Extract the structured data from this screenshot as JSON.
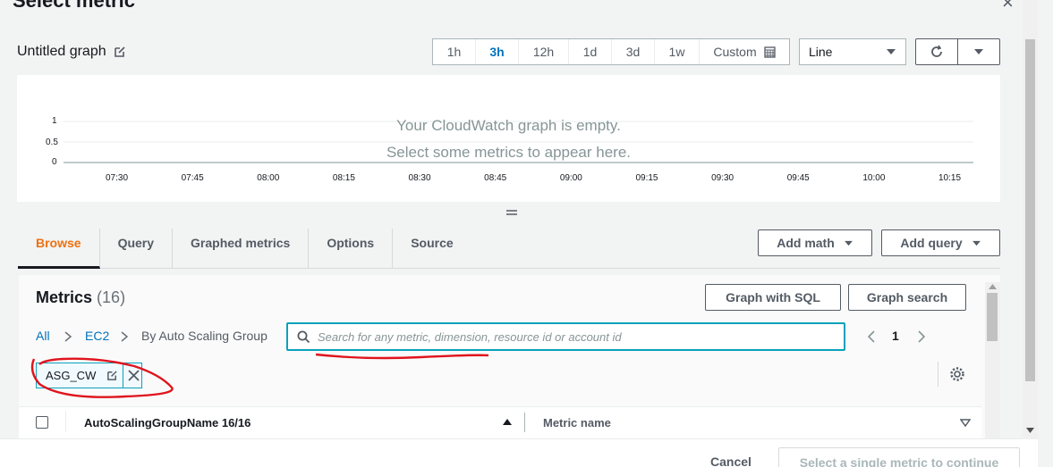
{
  "modal": {
    "title": "Select metric",
    "close_label": "×"
  },
  "graph": {
    "title": "Untitled graph",
    "empty_line1": "Your CloudWatch graph is empty.",
    "empty_line2": "Select some metrics to appear here.",
    "y_ticks": [
      "1",
      "0.5",
      "0"
    ],
    "x_ticks": [
      "07:30",
      "07:45",
      "08:00",
      "08:15",
      "08:30",
      "08:45",
      "09:00",
      "09:15",
      "09:30",
      "09:45",
      "10:00",
      "10:15"
    ]
  },
  "time_range": {
    "options": [
      "1h",
      "3h",
      "12h",
      "1d",
      "3d",
      "1w"
    ],
    "selected": "3h",
    "custom_label": "Custom"
  },
  "chart_type": {
    "selected": "Line"
  },
  "tabs": [
    "Browse",
    "Query",
    "Graphed metrics",
    "Options",
    "Source"
  ],
  "active_tab": "Browse",
  "actions": {
    "add_math": "Add math",
    "add_query": "Add query",
    "graph_sql": "Graph with SQL",
    "graph_search": "Graph search"
  },
  "metrics": {
    "heading": "Metrics",
    "count": "(16)",
    "breadcrumb": [
      "All",
      "EC2",
      "By Auto Scaling Group"
    ],
    "search_placeholder": "Search for any metric, dimension, resource id or account id",
    "page": "1",
    "token": "ASG_CW",
    "columns": [
      "AutoScalingGroupName 16/16",
      "Metric name"
    ]
  },
  "footer": {
    "cancel": "Cancel",
    "confirm": "Select a single metric to continue"
  },
  "colors": {
    "accent": "#0073bb",
    "active_tab": "#ec7211",
    "focus": "#0aa1bc",
    "annotation": "#e0141d"
  }
}
